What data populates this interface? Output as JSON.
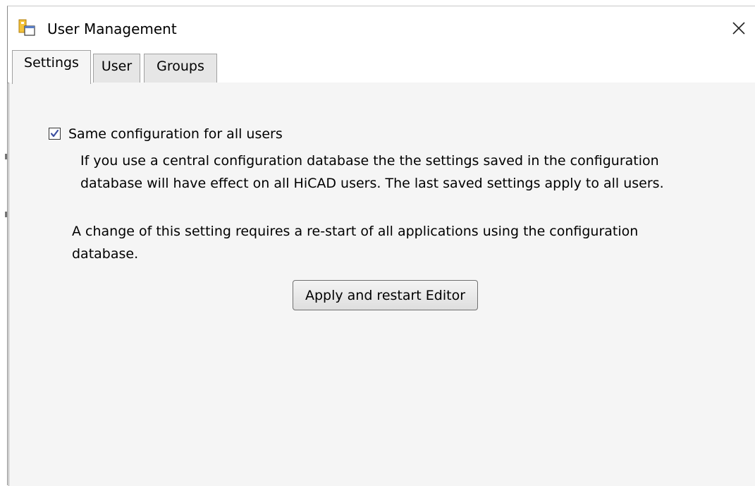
{
  "window": {
    "title": "User Management",
    "icon": "user-management-app-icon",
    "close_icon": "close-icon"
  },
  "tabs": [
    {
      "label": "Settings",
      "active": true
    },
    {
      "label": "User",
      "active": false
    },
    {
      "label": "Groups",
      "active": false
    }
  ],
  "settings": {
    "checkbox": {
      "label": "Same configuration for all users",
      "checked": true
    },
    "description_lines": [
      "If you use a central configuration database the the settings saved in the configuration",
      "database will have effect on all HiCAD users. The last saved settings apply to all users."
    ],
    "note_lines": [
      "A change of this setting requires a re-start of all applications using the configuration",
      "database."
    ],
    "apply_button_label": "Apply and restart Editor"
  },
  "colors": {
    "content_background": "#f5f5f5",
    "checkbox_check": "#3c4fa0",
    "tab_border": "#a0a0a0"
  }
}
